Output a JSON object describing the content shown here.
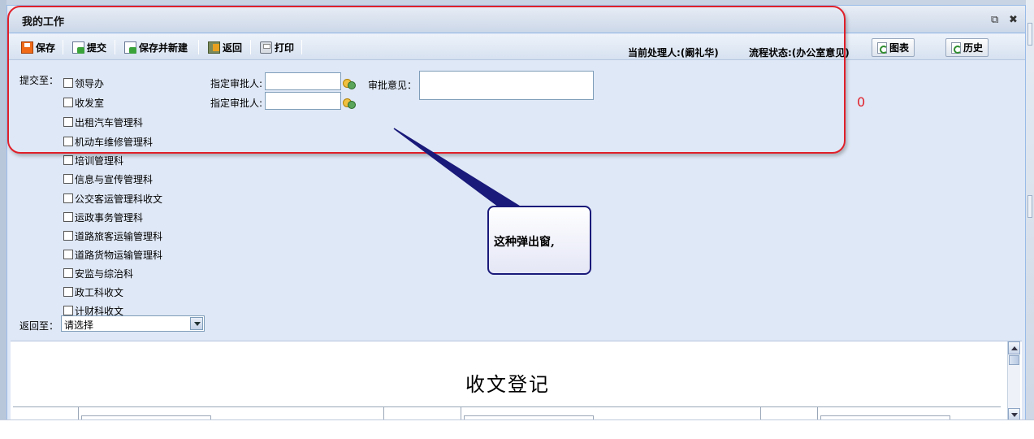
{
  "window": {
    "title": "我的工作",
    "restore_icon": "restore-icon",
    "close_icon": "close-icon"
  },
  "toolbar": {
    "save": "保存",
    "submit": "提交",
    "save_new": "保存并新建",
    "back": "返回",
    "print": "打印",
    "current_handler": "当前处理人:(阚礼华)",
    "flow_status": "流程状态:(办公室意见)",
    "chart": "图表",
    "history": "历史"
  },
  "form": {
    "submit_to_label": "提交至：",
    "departments": [
      "领导办",
      "收发室",
      "出租汽车管理科",
      "机动车维修管理科",
      "培训管理科",
      "信息与宣传管理科",
      "公交客运管理科收文",
      "运政事务管理科",
      "道路旅客运输管理科",
      "道路货物运输管理科",
      "安监与综治科",
      "政工科收文",
      "计财科收文"
    ],
    "approver_label_1": "指定审批人:",
    "approver_label_2": "指定审批人:",
    "approver_value_1": "",
    "approver_value_2": "",
    "opinion_label": "审批意见：",
    "opinion_value": "",
    "return_to_label": "返回至：",
    "return_to_selected": "请选择"
  },
  "document": {
    "title": "收文登记"
  },
  "annotation": {
    "mark": "0",
    "callout": "这种弹出窗,"
  },
  "colors": {
    "annotation_red": "#e0202a",
    "callout_border": "#1a1a7a",
    "window_bg": "#dfe8f6"
  }
}
